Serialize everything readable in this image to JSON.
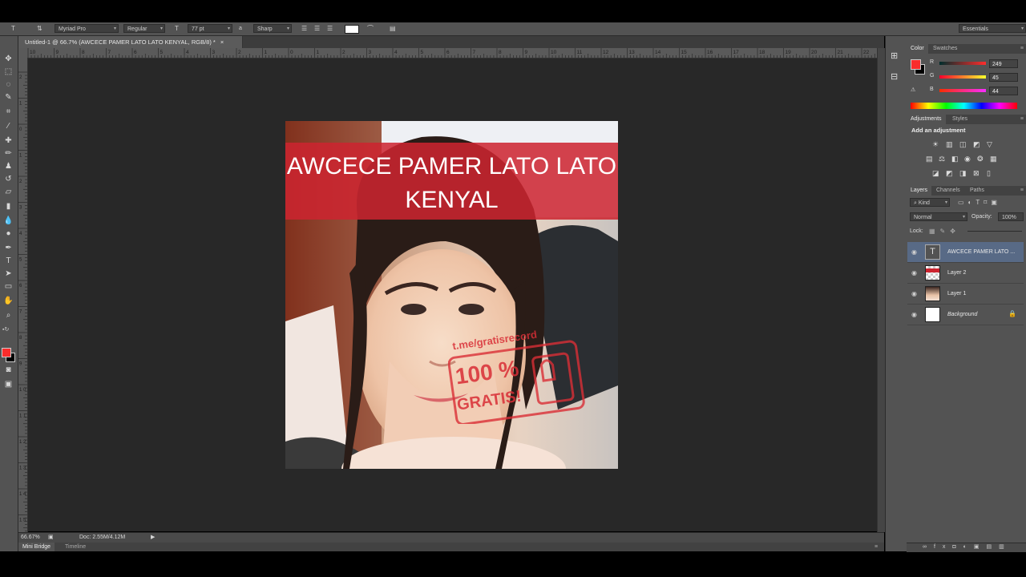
{
  "options_bar": {
    "font_family": "Myriad Pro",
    "font_style": "Regular",
    "font_size": "77 pt",
    "aa_label": "a",
    "antialias": "Sharp",
    "workspace": "Essentials"
  },
  "document": {
    "tab_title": "Untitled-1 @ 66.7% (AWCECE PAMER LATO LATO  KENYAL, RGB/8) *",
    "tab_close": "×",
    "zoom": "66.67%",
    "doc_info": "Doc: 2.55M/4.12M"
  },
  "canvas": {
    "title_line1": "AWCECE PAMER LATO LATO",
    "title_line2": "KENYAL",
    "stamp_url": "t.me/gratisrecord",
    "stamp_big": "100 %",
    "stamp_word": "GRATIS!"
  },
  "rulers": {
    "horizontal": [
      "10",
      "9",
      "8",
      "7",
      "6",
      "5",
      "4",
      "3",
      "2",
      "1",
      "0",
      "1",
      "2",
      "3",
      "4",
      "5",
      "6",
      "7",
      "8",
      "9",
      "10",
      "11",
      "12",
      "13",
      "14",
      "15",
      "16",
      "17",
      "18",
      "19",
      "20",
      "21",
      "22"
    ],
    "vertical": [
      "2",
      "1",
      "0",
      "1",
      "2",
      "3",
      "4",
      "5",
      "6",
      "7",
      "8",
      "9",
      "1 0",
      "1 1",
      "1 2",
      "1 3",
      "1 4",
      "1 5",
      "1 6",
      "1 7"
    ]
  },
  "bottom_tabs": {
    "mini_bridge": "Mini Bridge",
    "timeline": "Timeline"
  },
  "color_panel": {
    "tabs": [
      "Color",
      "Swatches"
    ],
    "r_label": "R",
    "r_value": "249",
    "g_label": "G",
    "g_value": "45",
    "b_label": "B",
    "b_value": "44",
    "foreground": "#f92d2c"
  },
  "adjustments_panel": {
    "tabs": [
      "Adjustments",
      "Styles"
    ],
    "heading": "Add an adjustment"
  },
  "layers_panel": {
    "tabs": [
      "Layers",
      "Channels",
      "Paths"
    ],
    "filter": "Kind",
    "blend_mode": "Normal",
    "opacity_label": "Opacity:",
    "opacity_value": "100%",
    "lock_label": "Lock:",
    "layers": [
      {
        "name": "AWCECE PAMER LATO ...",
        "type": "text",
        "selected": true
      },
      {
        "name": "Layer 2",
        "type": "raster",
        "selected": false
      },
      {
        "name": "Layer 1",
        "type": "photo",
        "selected": false
      },
      {
        "name": "Background",
        "type": "background",
        "selected": false
      }
    ]
  },
  "colors": {
    "foreground": "#f92d2c",
    "title_bar": "#cd2430",
    "stamp_red": "#d92e36",
    "workspace_bg": "#282828",
    "selected_layer": "#586a86"
  }
}
